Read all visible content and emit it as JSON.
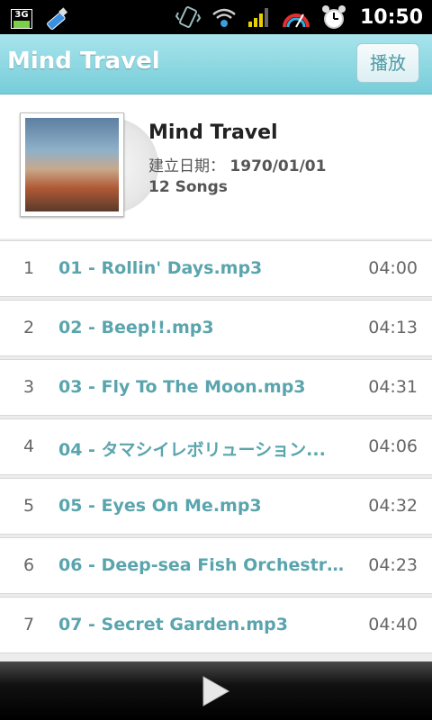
{
  "status_bar": {
    "network_badge": "3G",
    "time": "10:50",
    "icons": [
      "usb-icon",
      "vibrate-icon",
      "wifi-icon",
      "signal-icon",
      "battery-icon",
      "alarm-icon"
    ]
  },
  "title_bar": {
    "title": "Mind Travel",
    "play_label": "播放"
  },
  "album": {
    "title": "Mind Travel",
    "date_label": "建立日期：",
    "date_value": "1970/01/01",
    "song_count": "12 Songs"
  },
  "songs": [
    {
      "index": "1",
      "name": "01 - Rollin' Days.mp3",
      "duration": "04:00"
    },
    {
      "index": "2",
      "name": "02 - Beep!!.mp3",
      "duration": "04:13"
    },
    {
      "index": "3",
      "name": "03 - Fly To The Moon.mp3",
      "duration": "04:31"
    },
    {
      "index": "4",
      "name": "04 - タマシイレボリューション...",
      "duration": "04:06"
    },
    {
      "index": "5",
      "name": "05 - Eyes On Me.mp3",
      "duration": "04:32"
    },
    {
      "index": "6",
      "name": "06 - Deep-sea Fish Orchestra....",
      "duration": "04:23"
    },
    {
      "index": "7",
      "name": "07 - Secret Garden.mp3",
      "duration": "04:40"
    }
  ],
  "colors": {
    "accent": "#76cdd9",
    "song_title": "#5aa5ad",
    "status_bar": "#000000"
  }
}
